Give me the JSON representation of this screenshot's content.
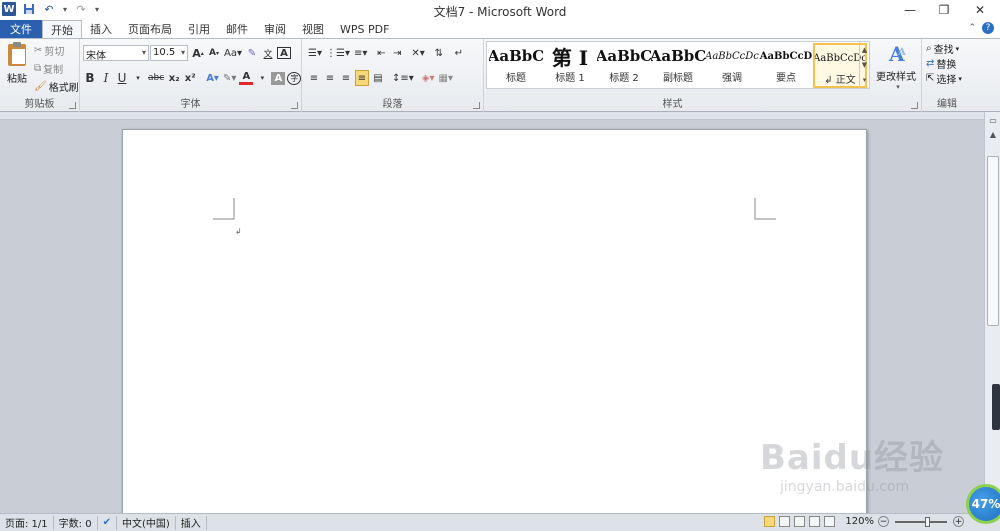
{
  "title": "文档7 - Microsoft Word",
  "qat": {
    "undo_arrow": "▾",
    "redo_sep": "|",
    "custom": "▾"
  },
  "tabs": [
    {
      "label": "文件"
    },
    {
      "label": "开始"
    },
    {
      "label": "插入"
    },
    {
      "label": "页面布局"
    },
    {
      "label": "引用"
    },
    {
      "label": "邮件"
    },
    {
      "label": "审阅"
    },
    {
      "label": "视图"
    },
    {
      "label": "WPS PDF"
    }
  ],
  "clipboard": {
    "paste": "粘贴",
    "cut": "剪切",
    "copy": "复制",
    "format_painter": "格式刷",
    "group": "剪贴板"
  },
  "font": {
    "name": "宋体",
    "size": "10.5",
    "group": "字体",
    "bold": "B",
    "italic": "I",
    "underline": "U",
    "strike": "abc",
    "sub": "x₂",
    "sup": "x²",
    "grow": "A",
    "shrink": "A",
    "case": "Aa",
    "clear": "ᴬ",
    "phonetic": "wén",
    "border_char": "A",
    "font_color": "A",
    "shade": "A",
    "enclose": "字"
  },
  "paragraph": {
    "group": "段落"
  },
  "styles": {
    "group": "样式",
    "items": [
      {
        "preview": "AaBbC",
        "label": "标题"
      },
      {
        "preview": "第 I",
        "label": "标题 1"
      },
      {
        "preview": "AaBbC",
        "label": "标题 2"
      },
      {
        "preview": "AaBbC",
        "label": "副标题"
      },
      {
        "preview": "AaBbCcDc",
        "label": "强调"
      },
      {
        "preview": "AaBbCcD",
        "label": "要点"
      },
      {
        "preview": "AaBbCcDc",
        "label": "↲ 正文"
      }
    ],
    "change": "更改样式"
  },
  "editing": {
    "group": "编辑",
    "find": "查找",
    "replace": "替换",
    "select": "选择"
  },
  "status": {
    "page": "页面: 1/1",
    "words": "字数: 0",
    "lang": "中文(中国)",
    "mode": "插入",
    "zoom": "120%",
    "minus": "−",
    "plus": "+"
  },
  "badge": "47%",
  "watermark": {
    "brand": "Baidu经验",
    "url": "jingyan.baidu.com"
  },
  "colors": {
    "file_tab": "#2b5fb0",
    "accent": "#2b579a",
    "selected_style": "#f2c14e"
  }
}
